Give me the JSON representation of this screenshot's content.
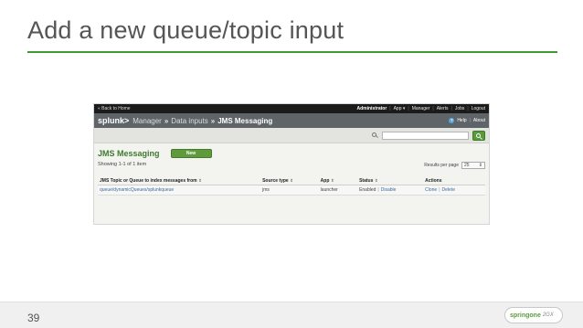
{
  "slide": {
    "title": "Add a new queue/topic input",
    "page_number": "39",
    "logo_text": "springone",
    "logo_suffix": "2GX",
    "accent_color": "#3f9b2f"
  },
  "topbar": {
    "back": "« Back to Home",
    "user": "Administrator",
    "items": [
      "App ▾",
      "Manager",
      "Alerts",
      "Jobs",
      "Logout"
    ]
  },
  "header": {
    "logo": "splunk>",
    "crumbs": [
      "Manager",
      "Data inputs"
    ],
    "current": "JMS Messaging",
    "help": "Help",
    "about": "About"
  },
  "search": {
    "value": "",
    "placeholder": ""
  },
  "page": {
    "heading": "JMS Messaging",
    "new_label": "New",
    "showing": "Showing 1-1 of 1 item",
    "rpp_label": "Results per page",
    "rpp_value": "25"
  },
  "table": {
    "columns": [
      "JMS Topic or Queue to index messages from",
      "Source type",
      "App",
      "Status",
      "Actions"
    ],
    "rows": [
      {
        "name": "queue/dynamicQueues/splunkqueue",
        "source_type": "jms",
        "app": "launcher",
        "status": "Enabled",
        "status_action": "Disable",
        "actions": [
          "Clone",
          "Delete"
        ]
      }
    ]
  }
}
